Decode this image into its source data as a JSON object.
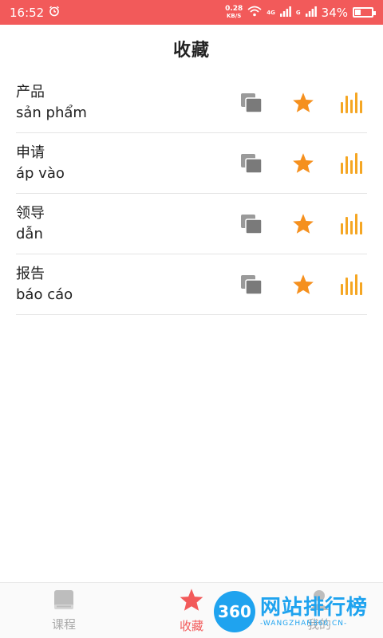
{
  "status_bar": {
    "time": "16:52",
    "net_speed": "0.28",
    "net_speed_unit": "KB/S",
    "net_tag_1": "4G",
    "net_tag_2": "G",
    "battery": "34%",
    "battery_level": 0.34
  },
  "header": {
    "title": "收藏"
  },
  "items": [
    {
      "hanzi": "产品",
      "viet": "sản phẩm"
    },
    {
      "hanzi": "申请",
      "viet": "áp vào"
    },
    {
      "hanzi": "领导",
      "viet": "dẫn"
    },
    {
      "hanzi": "报告",
      "viet": "báo cáo"
    }
  ],
  "colors": {
    "accent": "#f25a5a",
    "star": "#f5901e",
    "bars": "#f5a623",
    "copy": "#7a7a7a"
  },
  "bottom_nav": {
    "items": [
      {
        "label": "课程",
        "icon": "book-icon",
        "active": false
      },
      {
        "label": "收藏",
        "icon": "star-icon",
        "active": true
      },
      {
        "label": "我的",
        "icon": "user-icon",
        "active": false
      }
    ]
  },
  "watermark": {
    "circle": "360",
    "title": "网站排行榜",
    "subtitle": "-WANGZHAN360.CN-"
  }
}
